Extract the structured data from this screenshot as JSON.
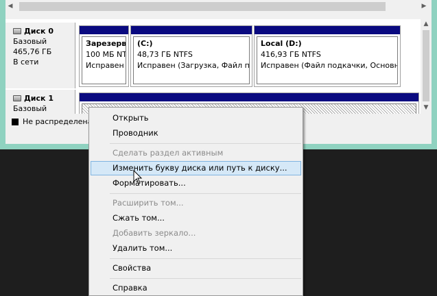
{
  "disks": [
    {
      "name": "Диск 0",
      "type": "Базовый",
      "size": "465,76 ГБ",
      "status": "В сети",
      "partitions": [
        {
          "name": "Зарезерви",
          "size": "100 МБ NTI",
          "state": "Исправен ("
        },
        {
          "name": "(C:)",
          "size": "48,73 ГБ NTFS",
          "state": "Исправен (Загрузка, Файл по,"
        },
        {
          "name": "Local  (D:)",
          "size": "416,93 ГБ NTFS",
          "state": "Исправен (Файл подкачки, Основно"
        }
      ]
    },
    {
      "name": "Диск 1",
      "type": "Базовый"
    }
  ],
  "legend": {
    "label": "Не распределена"
  },
  "menu": {
    "items": [
      {
        "label": "Открыть",
        "enabled": true
      },
      {
        "label": "Проводник",
        "enabled": true
      },
      {
        "label": "Сделать раздел активным",
        "enabled": false
      },
      {
        "label": "Изменить букву диска или путь к диску...",
        "enabled": true,
        "hovered": true
      },
      {
        "label": "Форматировать...",
        "enabled": true
      },
      {
        "label": "Расширить том...",
        "enabled": false
      },
      {
        "label": "Сжать том...",
        "enabled": true
      },
      {
        "label": "Добавить зеркало...",
        "enabled": false
      },
      {
        "label": "Удалить том...",
        "enabled": true
      },
      {
        "label": "Свойства",
        "enabled": true
      },
      {
        "label": "Справка",
        "enabled": true
      }
    ]
  },
  "colors": {
    "partition_bar": "#0a0a80",
    "window_frame": "#8fd2c0",
    "menu_hover": "#d5e8f7"
  }
}
